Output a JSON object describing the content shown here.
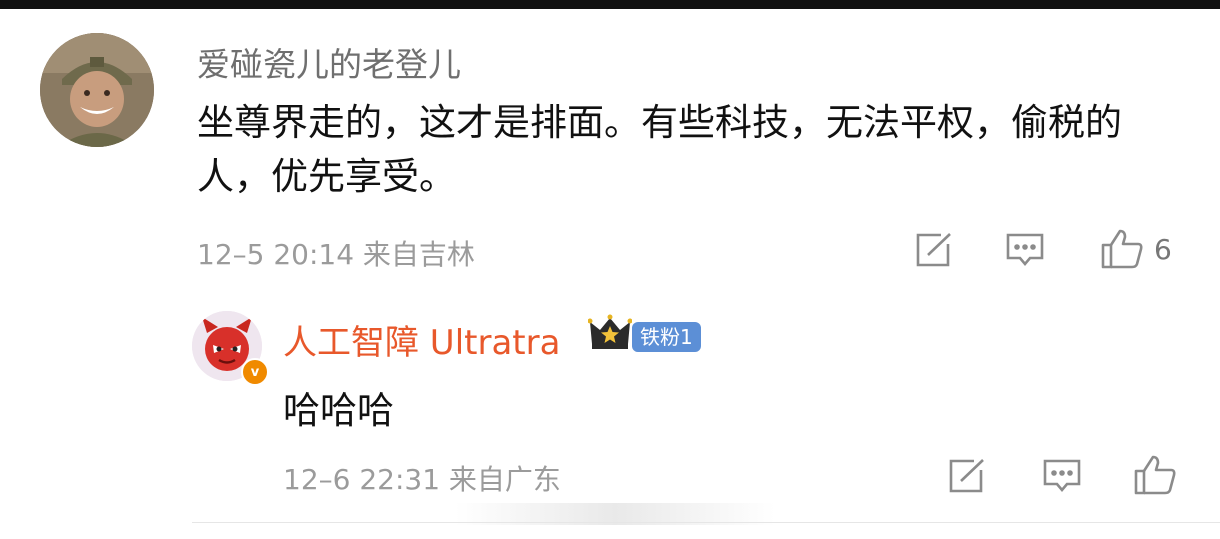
{
  "comment": {
    "author": "爱碰瓷儿的老登儿",
    "text": "坐尊界走的，这才是排面。有些科技，无法平权，偷税的人，优先享受。",
    "meta": "12–5 20:14 来自吉林",
    "likes": "6",
    "icons": {
      "share": "share-icon",
      "reply": "comment-icon",
      "like": "like-icon"
    }
  },
  "reply": {
    "author": "人工智障 Ultratra",
    "fan_badge": "铁粉1",
    "text": "哈哈哈",
    "meta": "12–6 22:31 来自广东",
    "icons": {
      "crown": "crown-icon",
      "verified": "verified-icon",
      "share": "share-icon",
      "reply": "comment-icon",
      "like": "like-icon"
    }
  },
  "colors": {
    "reply_author": "#e8582b",
    "meta": "#9b9b9b",
    "badge": "#5c8fd6",
    "verified": "#f08a00"
  }
}
